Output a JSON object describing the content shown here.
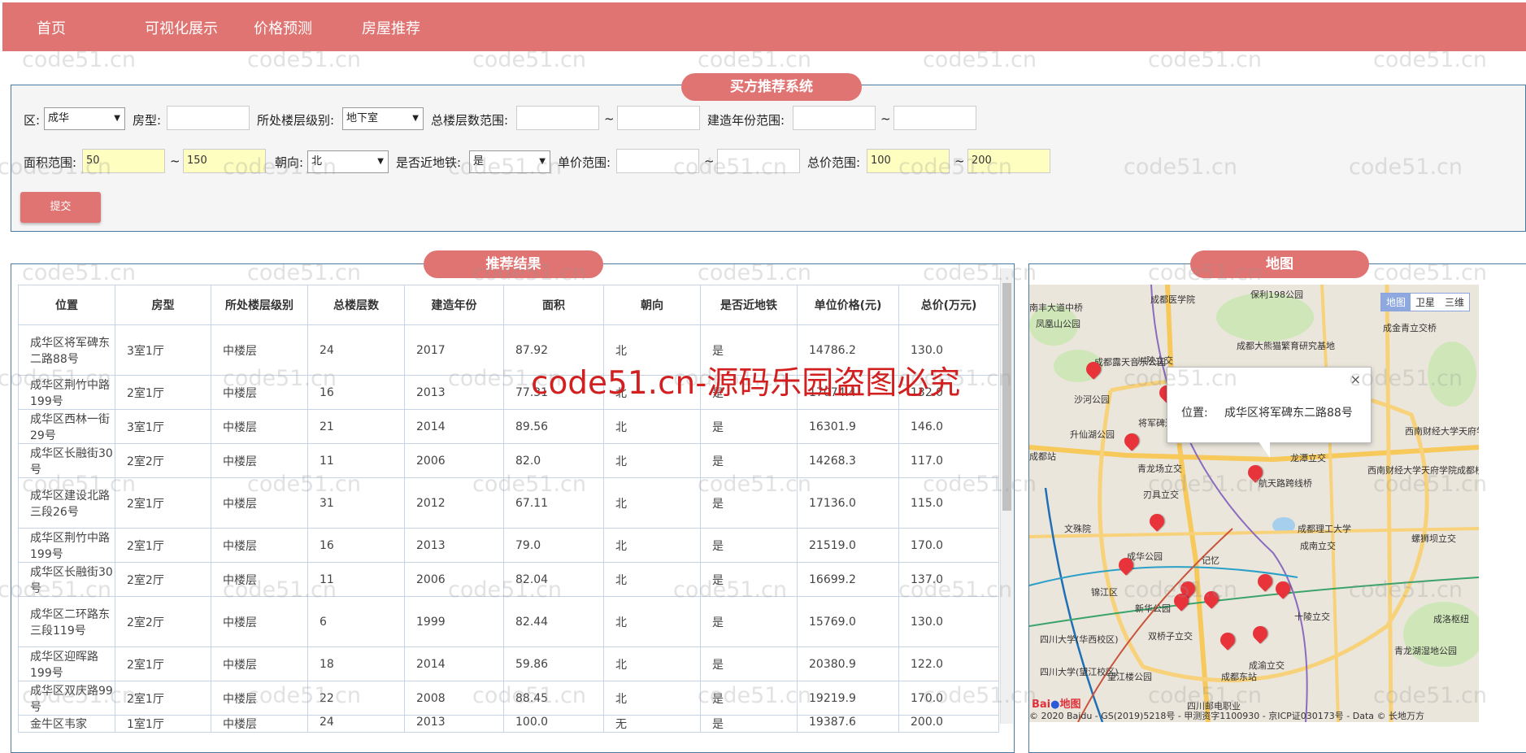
{
  "nav": {
    "items": [
      "首页",
      "可视化展示",
      "价格预测",
      "房屋推荐"
    ]
  },
  "form": {
    "title": "买方推荐系统",
    "district_label": "区:",
    "district_value": "成华",
    "layout_label": "房型:",
    "layout_value": "",
    "floor_level_label": "所处楼层级别:",
    "floor_level_value": "地下室",
    "total_floors_label": "总楼层数范围:",
    "total_floors_min": "",
    "total_floors_max": "",
    "year_label": "建造年份范围:",
    "year_min": "",
    "year_max": "",
    "area_label": "面积范围:",
    "area_min": "50",
    "area_max": "150",
    "orientation_label": "朝向:",
    "orientation_value": "北",
    "subway_label": "是否近地铁:",
    "subway_value": "是",
    "unit_price_label": "单价范围:",
    "unit_price_min": "",
    "unit_price_max": "",
    "total_price_label": "总价范围:",
    "total_price_min": "100",
    "total_price_max": "200",
    "tilde": "~",
    "submit_label": "提交"
  },
  "results": {
    "title": "推荐结果",
    "columns": [
      "位置",
      "房型",
      "所处楼层级别",
      "总楼层数",
      "建造年份",
      "面积",
      "朝向",
      "是否近地铁",
      "单位价格(元)",
      "总价(万元)"
    ],
    "rows": [
      [
        "成华区将军碑东二路88号",
        "3室1厅",
        "中楼层",
        "24",
        "2017",
        "87.92",
        "北",
        "是",
        "14786.2",
        "130.0"
      ],
      [
        "成华区荆竹中路199号",
        "2室1厅",
        "中楼层",
        "16",
        "2013",
        "77.31",
        "北",
        "是",
        "17074.4",
        "132.0"
      ],
      [
        "成华区西林一街29号",
        "3室1厅",
        "中楼层",
        "21",
        "2014",
        "89.56",
        "北",
        "是",
        "16301.9",
        "146.0"
      ],
      [
        "成华区长融街30号",
        "2室2厅",
        "中楼层",
        "11",
        "2006",
        "82.0",
        "北",
        "是",
        "14268.3",
        "117.0"
      ],
      [
        "成华区建设北路三段26号",
        "2室1厅",
        "中楼层",
        "31",
        "2012",
        "67.11",
        "北",
        "是",
        "17136.0",
        "115.0"
      ],
      [
        "成华区荆竹中路199号",
        "2室1厅",
        "中楼层",
        "16",
        "2013",
        "79.0",
        "北",
        "是",
        "21519.0",
        "170.0"
      ],
      [
        "成华区长融街30号",
        "2室2厅",
        "中楼层",
        "11",
        "2006",
        "82.04",
        "北",
        "是",
        "16699.2",
        "137.0"
      ],
      [
        "成华区二环路东三段119号",
        "2室2厅",
        "中楼层",
        "6",
        "1999",
        "82.44",
        "北",
        "是",
        "15769.0",
        "130.0"
      ],
      [
        "成华区迎晖路199号",
        "2室1厅",
        "中楼层",
        "18",
        "2014",
        "59.86",
        "北",
        "是",
        "20380.9",
        "122.0"
      ],
      [
        "成华区双庆路99号",
        "2室1厅",
        "中楼层",
        "22",
        "2008",
        "88.45",
        "北",
        "是",
        "19219.9",
        "170.0"
      ],
      [
        "金牛区韦家",
        "1室1厅",
        "中楼层",
        "24",
        "2013",
        "100.0",
        "无",
        "是",
        "19387.6",
        "200.0"
      ]
    ]
  },
  "map": {
    "title": "地图",
    "map_types": [
      "地图",
      "卫星",
      "三维"
    ],
    "popup_label": "位置:",
    "popup_value": "成华区将军碑东二路88号",
    "popup_close": "×",
    "copyright": "© 2020 Baidu - GS(2019)5218号 - 甲测资字1100930 - 京ICP证030173号 - Data © 长地万方",
    "logo_text": "地图",
    "logo_brand": "Bai",
    "places": [
      "成都医学院",
      "保利198公园",
      "成都大熊猫繁育研究基地",
      "成金青立交桥",
      "凤凰山公园",
      "成都露天音乐公园",
      "川陕立交",
      "沙河公园",
      "升仙湖公园",
      "将军碑遗址",
      "西南财经大学天府学院(成都东区)",
      "龙潭立交",
      "青龙场立交",
      "西南财经大学天府学院成都校区(西区)",
      "航天路跨线桥",
      "成都站",
      "刃具立交",
      "文殊院",
      "成都理工大学",
      "成南立交",
      "螺狮坝立交",
      "成华公园",
      "记忆",
      "锦江区",
      "新华公园",
      "十陵立交",
      "成洛枢纽",
      "四川大学(华西校区)",
      "双桥子立交",
      "青龙湖湿地公园",
      "成渝立交",
      "四川大学(望江校区)",
      "望江楼公园",
      "成都东站",
      "四川邮电职业",
      "南丰大道中桥"
    ]
  },
  "watermark": {
    "main": "code51.cn-源码乐园盗图必究",
    "tile": "code51.cn"
  },
  "colors": {
    "accent": "#e07472",
    "highlight_input": "#fefec0",
    "border": "#4a7aa0"
  }
}
